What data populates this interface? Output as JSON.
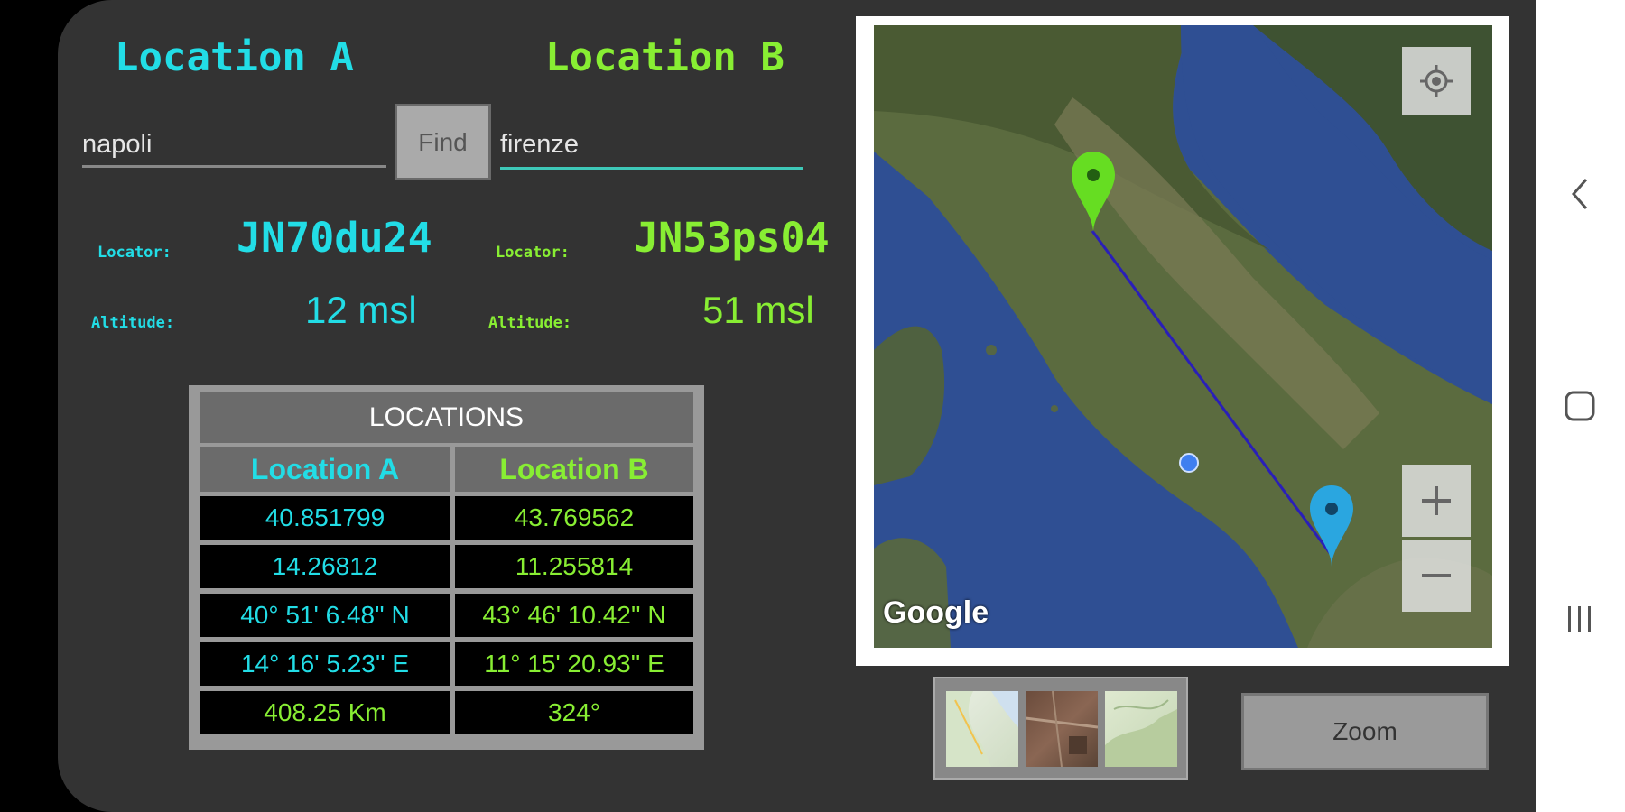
{
  "location_a": {
    "header": "Location A",
    "input_value": "napoli",
    "locator_label": "Locator:",
    "locator_value": "JN70du24",
    "altitude_label": "Altitude:",
    "altitude_value": "12 msl"
  },
  "location_b": {
    "header": "Location B",
    "input_value": "firenze",
    "locator_label": "Locator:",
    "locator_value": "JN53ps04",
    "altitude_label": "Altitude:",
    "altitude_value": "51 msl"
  },
  "find_button": "Find",
  "table": {
    "title": "LOCATIONS",
    "col_a": "Location A",
    "col_b": "Location B",
    "rows": [
      [
        "40.851799",
        "43.769562"
      ],
      [
        "14.26812",
        "11.255814"
      ],
      [
        "40° 51' 6.48'' N",
        "43° 46' 10.42'' N"
      ],
      [
        "14° 16' 5.23'' E",
        "11° 15' 20.93'' E"
      ],
      [
        "408.25 Km",
        "324°"
      ]
    ]
  },
  "map": {
    "attribution": "Google",
    "my_location_icon": "crosshair-icon",
    "zoom_in_icon": "plus-icon",
    "zoom_out_icon": "minus-icon"
  },
  "zoom_button": "Zoom",
  "colors": {
    "location_a": "#22dde6",
    "location_b": "#88ee33",
    "panel_bg": "#333333"
  }
}
